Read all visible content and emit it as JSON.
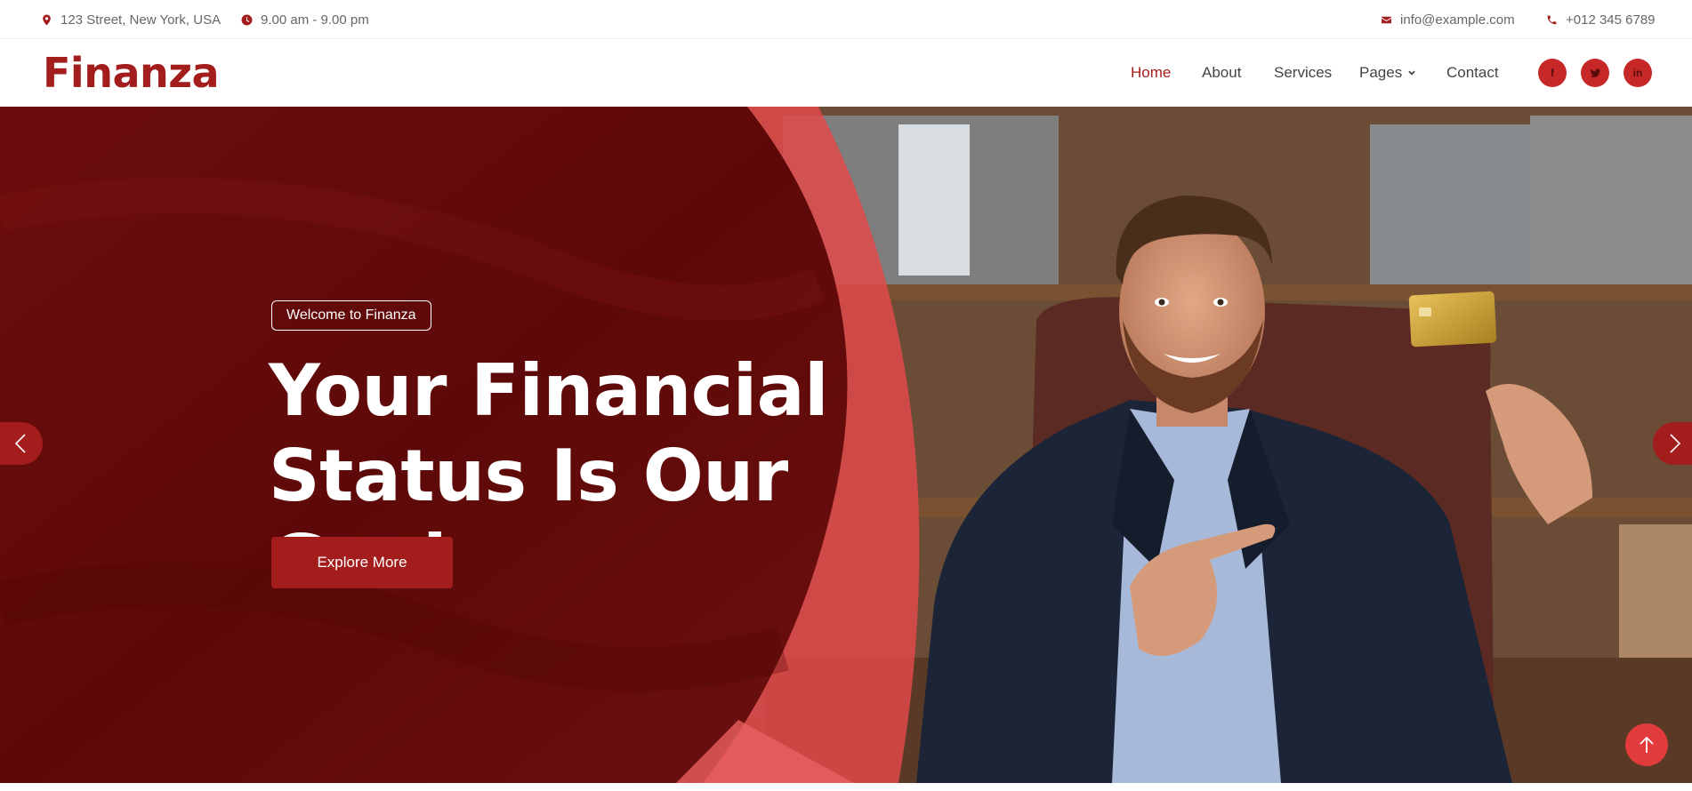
{
  "topbar": {
    "address": "123 Street, New York, USA",
    "hours": "9.00 am - 9.00 pm",
    "email": "info@example.com",
    "phone": "+012 345 6789"
  },
  "brand": {
    "name": "Finanza",
    "color": "#a31d1d"
  },
  "nav": {
    "items": [
      {
        "label": "Home",
        "active": true
      },
      {
        "label": "About",
        "active": false
      },
      {
        "label": "Services",
        "active": false
      },
      {
        "label": "Pages",
        "active": false,
        "has_dropdown": true
      },
      {
        "label": "Contact",
        "active": false
      }
    ],
    "social": [
      {
        "icon": "facebook-icon",
        "glyph": "f"
      },
      {
        "icon": "twitter-icon",
        "glyph": ""
      },
      {
        "icon": "linkedin-icon",
        "glyph": "in"
      }
    ]
  },
  "hero": {
    "badge": "Welcome to Finanza",
    "title_line1": "Your Financial",
    "title_line2": "Status Is Our Goal",
    "cta": "Explore More",
    "prev_icon": "chevron-left-icon",
    "next_icon": "chevron-right-icon"
  },
  "back_to_top_icon": "arrow-up-icon",
  "colors": {
    "accent": "#a31d1d",
    "hero_dark_red": "#5e0b0b",
    "hero_light_red": "#e04a4a",
    "back_to_top": "#e23b3b"
  }
}
